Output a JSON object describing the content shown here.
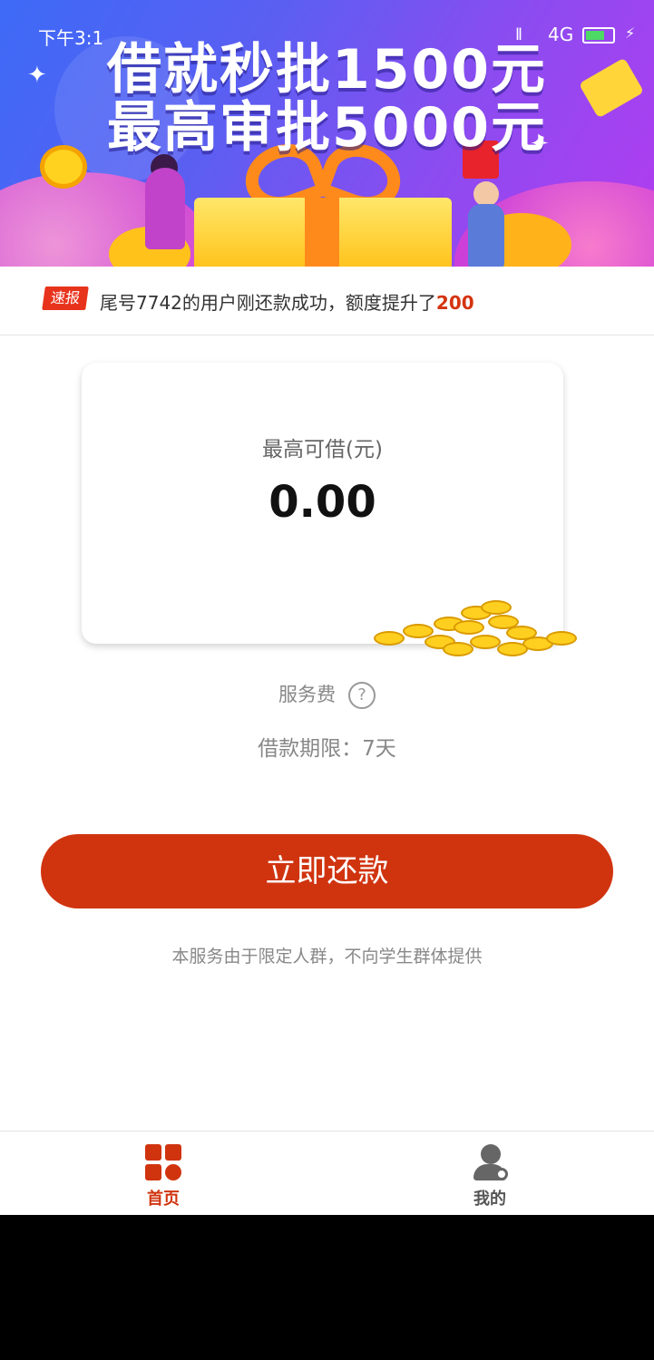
{
  "status_bar": {
    "time": "下午3:1",
    "signal": "ll",
    "network": "4G",
    "charging": "⚡"
  },
  "banner": {
    "headline_line1": "借就秒批1500元",
    "headline_line2": "最高审批5000元"
  },
  "ticker": {
    "badge": "速报",
    "message_prefix": "尾号7742的用户刚还款成功，额度提升了",
    "message_highlight": "200"
  },
  "loan_card": {
    "label": "最高可借(元)",
    "amount": "0.00"
  },
  "service_fee": {
    "label": "服务费",
    "help_icon": "?"
  },
  "loan_term": "借款期限：7天",
  "primary_action": {
    "label": "立即还款"
  },
  "disclaimer": "本服务由于限定人群，不向学生群体提供",
  "tabbar": {
    "home_label": "首页",
    "mine_label": "我的"
  },
  "colors": {
    "accent": "#d0340f",
    "banner_start": "#3d6af7",
    "banner_end": "#b33cf0"
  }
}
